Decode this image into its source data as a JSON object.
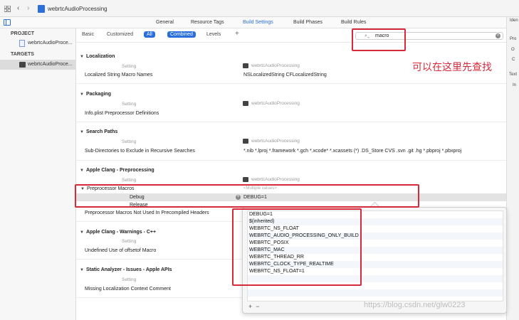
{
  "window": {
    "file_title": "webrtcAudioProcessing"
  },
  "tabs": [
    {
      "label": "General"
    },
    {
      "label": "Resource Tags"
    },
    {
      "label": "Build Settings"
    },
    {
      "label": "Build Phases"
    },
    {
      "label": "Build Rules"
    }
  ],
  "inspector": {
    "labels": [
      "Iden",
      "Pro",
      "O",
      "C",
      "Text",
      "In"
    ]
  },
  "sidebar": {
    "project_header": "PROJECT",
    "project_item": "webrtcAudioProce...",
    "targets_header": "TARGETS",
    "target_item": "webrtcAudioProce..."
  },
  "filterbar": {
    "basic": "Basic",
    "customized": "Customized",
    "all": "All",
    "combined": "Combined",
    "levels": "Levels",
    "add": "+",
    "search_value": "macro"
  },
  "columns": {
    "setting": "Setting",
    "target": "webrtcAudioProcessing"
  },
  "sections": {
    "localization": {
      "title": "Localization",
      "rows": [
        {
          "name": "Localized String Macro Names",
          "value": "NSLocalizedString CFLocalizedString"
        }
      ]
    },
    "packaging": {
      "title": "Packaging",
      "rows": [
        {
          "name": "Info.plist Preprocessor Definitions",
          "value": ""
        }
      ]
    },
    "search_paths": {
      "title": "Search Paths",
      "rows": [
        {
          "name": "Sub-Directories to Exclude in Recursive Searches",
          "value": "*.nib *.lproj *.framework *.gch *.xcode* *.xcassets (*) .DS_Store CVS .svn .git .hg *.pbproj *.pbxproj"
        }
      ]
    },
    "clang_pre": {
      "title": "Apple Clang - Preprocessing",
      "macros_row": "Preprocessor Macros",
      "macros_value": "<Multiple values>",
      "debug_label": "Debug",
      "debug_value": "DEBUG=1",
      "release_label": "Release",
      "not_used_row": "Preprocessor Macros Not Used In Precompiled Headers"
    },
    "clang_warn": {
      "title": "Apple Clang - Warnings - C++",
      "rows": [
        {
          "name": "Undefined Use of offsetof Macro",
          "value": ""
        }
      ]
    },
    "static_analyzer": {
      "title": "Static Analyzer - Issues - Apple APIs",
      "rows": [
        {
          "name": "Missing Localization Context Comment",
          "value": ""
        }
      ]
    }
  },
  "popover": {
    "macros": [
      "DEBUG=1",
      "$(inherited)",
      "WEBRTC_NS_FLOAT",
      "WEBRTC_AUDIO_PROCESSING_ONLY_BUILD",
      "WEBRTC_POSIX",
      "WEBRTC_MAC",
      "WEBRTC_THREAD_RR",
      "WEBRTC_CLOCK_TYPE_REALTIME",
      "WEBRTC_NS_FLOAT=1"
    ],
    "add_label": "+",
    "remove_label": "−"
  },
  "annotation": "可以在这里先查找",
  "watermark": "https://blog.csdn.net/glw0223",
  "colors": {
    "accent": "#2a6fdc",
    "annotation_red": "#d6293a"
  }
}
